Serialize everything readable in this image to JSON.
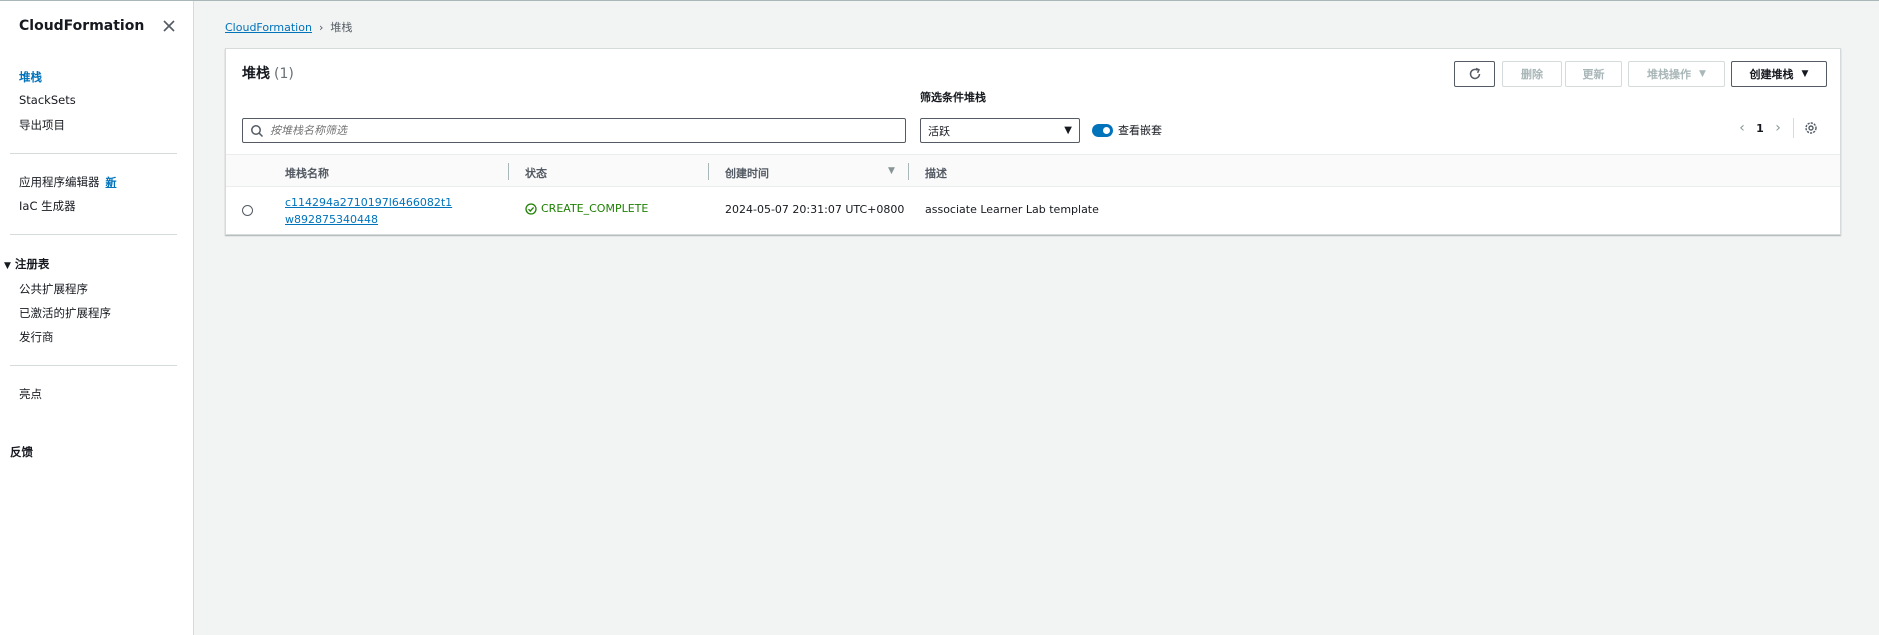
{
  "sidebar": {
    "title": "CloudFormation",
    "items_primary": [
      {
        "label": "堆栈",
        "active": true
      },
      {
        "label": "StackSets"
      },
      {
        "label": "导出项目"
      }
    ],
    "app_composer": {
      "label": "应用程序编辑器",
      "badge": "新"
    },
    "iac_generator": "IaC 生成器",
    "registry": {
      "label": "注册表",
      "items": [
        "公共扩展程序",
        "已激活的扩展程序",
        "发行商"
      ]
    },
    "spotlight": "亮点",
    "feedback": "反馈"
  },
  "breadcrumb": {
    "root": "CloudFormation",
    "current": "堆栈"
  },
  "panel": {
    "title": "堆栈",
    "count": "(1)",
    "buttons": {
      "delete": "删除",
      "update": "更新",
      "stack_actions": "堆栈操作",
      "create_stack": "创建堆栈"
    },
    "search_placeholder": "按堆栈名称筛选",
    "filter_label": "筛选条件堆栈",
    "filter_value": "活跃",
    "toggle_label": "查看嵌套",
    "page": "1"
  },
  "table": {
    "headers": [
      "堆栈名称",
      "状态",
      "创建时间",
      "描述"
    ],
    "rows": [
      {
        "name": "c114294a2710197l6466082t1w892875340448",
        "status": "CREATE_COMPLETE",
        "created": "2024-05-07 20:31:07 UTC+0800",
        "description": "associate Learner Lab template"
      }
    ]
  },
  "colors": {
    "link": "#0073bb",
    "success": "#1d8102",
    "toggle_on": "#0073bb"
  },
  "icons": [
    "close-icon",
    "refresh-icon",
    "search-icon",
    "chevron-left-icon",
    "chevron-right-icon",
    "gear-icon",
    "status-success-icon",
    "caret-down-icon"
  ]
}
